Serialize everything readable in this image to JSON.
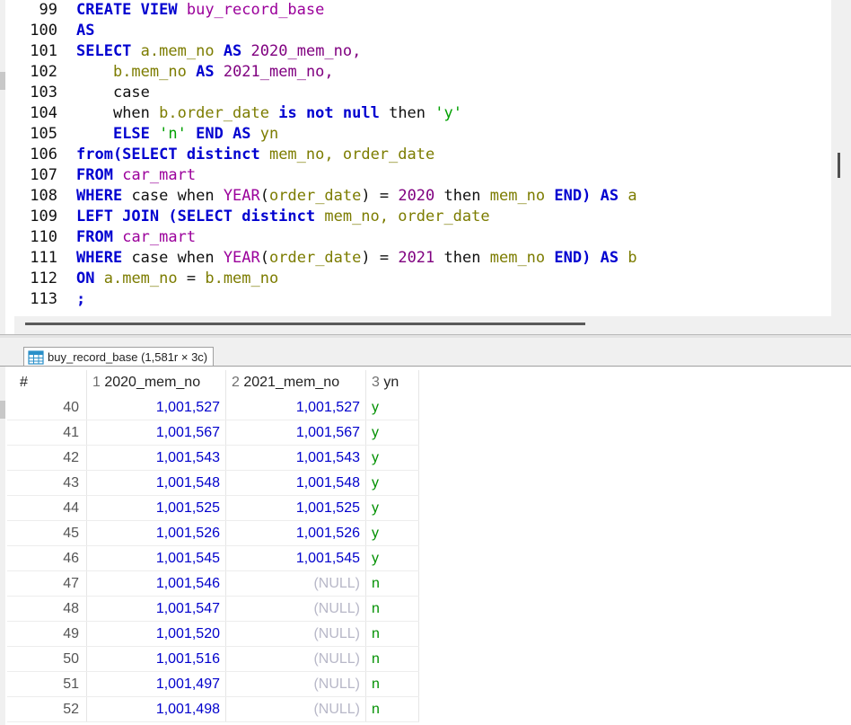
{
  "editor": {
    "lines": [
      {
        "n": "99",
        "tokens": [
          {
            "t": "CREATE VIEW",
            "c": "kw"
          },
          {
            "t": " ",
            "c": "plain"
          },
          {
            "t": "buy_record_base",
            "c": "fn"
          }
        ]
      },
      {
        "n": "100",
        "tokens": [
          {
            "t": "AS",
            "c": "kw"
          }
        ]
      },
      {
        "n": "101",
        "tokens": [
          {
            "t": "SELECT",
            "c": "kw"
          },
          {
            "t": " ",
            "c": "plain"
          },
          {
            "t": "a.mem_no",
            "c": "ident"
          },
          {
            "t": " ",
            "c": "plain"
          },
          {
            "t": "AS",
            "c": "kw"
          },
          {
            "t": " ",
            "c": "plain"
          },
          {
            "t": "2020_mem_no,",
            "c": "num"
          }
        ]
      },
      {
        "n": "102",
        "tokens": [
          {
            "t": "    ",
            "c": "plain"
          },
          {
            "t": "b.mem_no",
            "c": "ident"
          },
          {
            "t": " ",
            "c": "plain"
          },
          {
            "t": "AS",
            "c": "kw"
          },
          {
            "t": " ",
            "c": "plain"
          },
          {
            "t": "2021_mem_no,",
            "c": "num"
          }
        ]
      },
      {
        "n": "103",
        "tokens": [
          {
            "t": "    ",
            "c": "plain"
          },
          {
            "t": "case",
            "c": "plain"
          }
        ]
      },
      {
        "n": "104",
        "tokens": [
          {
            "t": "    ",
            "c": "plain"
          },
          {
            "t": "when",
            "c": "plain"
          },
          {
            "t": " ",
            "c": "plain"
          },
          {
            "t": "b.order_date",
            "c": "ident"
          },
          {
            "t": " ",
            "c": "plain"
          },
          {
            "t": "is not null",
            "c": "kw"
          },
          {
            "t": " ",
            "c": "plain"
          },
          {
            "t": "then",
            "c": "plain"
          },
          {
            "t": " ",
            "c": "plain"
          },
          {
            "t": "'y'",
            "c": "str"
          }
        ]
      },
      {
        "n": "105",
        "tokens": [
          {
            "t": "    ",
            "c": "plain"
          },
          {
            "t": "ELSE",
            "c": "kw"
          },
          {
            "t": " ",
            "c": "plain"
          },
          {
            "t": "'n'",
            "c": "str"
          },
          {
            "t": " ",
            "c": "plain"
          },
          {
            "t": "END AS",
            "c": "kw"
          },
          {
            "t": " ",
            "c": "plain"
          },
          {
            "t": "yn",
            "c": "ident"
          }
        ]
      },
      {
        "n": "106",
        "tokens": [
          {
            "t": "from(SELECT distinct",
            "c": "kw"
          },
          {
            "t": " ",
            "c": "plain"
          },
          {
            "t": "mem_no,",
            "c": "ident"
          },
          {
            "t": " ",
            "c": "plain"
          },
          {
            "t": "order_date",
            "c": "ident"
          }
        ]
      },
      {
        "n": "107",
        "tokens": [
          {
            "t": "FROM",
            "c": "kw"
          },
          {
            "t": " ",
            "c": "plain"
          },
          {
            "t": "car_mart",
            "c": "fn"
          }
        ]
      },
      {
        "n": "108",
        "tokens": [
          {
            "t": "WHERE",
            "c": "kw"
          },
          {
            "t": " ",
            "c": "plain"
          },
          {
            "t": "case when",
            "c": "plain"
          },
          {
            "t": " ",
            "c": "plain"
          },
          {
            "t": "YEAR",
            "c": "fn"
          },
          {
            "t": "(",
            "c": "plain"
          },
          {
            "t": "order_date",
            "c": "ident"
          },
          {
            "t": ") = ",
            "c": "plain"
          },
          {
            "t": "2020",
            "c": "num"
          },
          {
            "t": " ",
            "c": "plain"
          },
          {
            "t": "then",
            "c": "plain"
          },
          {
            "t": " ",
            "c": "plain"
          },
          {
            "t": "mem_no",
            "c": "ident"
          },
          {
            "t": " ",
            "c": "plain"
          },
          {
            "t": "END) AS",
            "c": "kw"
          },
          {
            "t": " ",
            "c": "plain"
          },
          {
            "t": "a",
            "c": "ident"
          }
        ]
      },
      {
        "n": "109",
        "tokens": [
          {
            "t": "LEFT JOIN (SELECT distinct",
            "c": "kw"
          },
          {
            "t": " ",
            "c": "plain"
          },
          {
            "t": "mem_no,",
            "c": "ident"
          },
          {
            "t": " ",
            "c": "plain"
          },
          {
            "t": "order_date",
            "c": "ident"
          }
        ]
      },
      {
        "n": "110",
        "tokens": [
          {
            "t": "FROM",
            "c": "kw"
          },
          {
            "t": " ",
            "c": "plain"
          },
          {
            "t": "car_mart",
            "c": "fn"
          }
        ]
      },
      {
        "n": "111",
        "tokens": [
          {
            "t": "WHERE",
            "c": "kw"
          },
          {
            "t": " ",
            "c": "plain"
          },
          {
            "t": "case when",
            "c": "plain"
          },
          {
            "t": " ",
            "c": "plain"
          },
          {
            "t": "YEAR",
            "c": "fn"
          },
          {
            "t": "(",
            "c": "plain"
          },
          {
            "t": "order_date",
            "c": "ident"
          },
          {
            "t": ") = ",
            "c": "plain"
          },
          {
            "t": "2021",
            "c": "num"
          },
          {
            "t": " ",
            "c": "plain"
          },
          {
            "t": "then",
            "c": "plain"
          },
          {
            "t": " ",
            "c": "plain"
          },
          {
            "t": "mem_no",
            "c": "ident"
          },
          {
            "t": " ",
            "c": "plain"
          },
          {
            "t": "END) AS",
            "c": "kw"
          },
          {
            "t": " ",
            "c": "plain"
          },
          {
            "t": "b",
            "c": "ident"
          }
        ]
      },
      {
        "n": "112",
        "tokens": [
          {
            "t": "ON",
            "c": "kw"
          },
          {
            "t": " ",
            "c": "plain"
          },
          {
            "t": "a.mem_no",
            "c": "ident"
          },
          {
            "t": " = ",
            "c": "plain"
          },
          {
            "t": "b.mem_no",
            "c": "ident"
          }
        ]
      },
      {
        "n": "113",
        "tokens": [
          {
            "t": ";",
            "c": "kw"
          }
        ]
      }
    ]
  },
  "results": {
    "tab_label": "buy_record_base (1,581r × 3c)",
    "columns": {
      "rownum": "#",
      "c1_idx": "1",
      "c1": "2020_mem_no",
      "c2_idx": "2",
      "c2": "2021_mem_no",
      "c3_idx": "3",
      "c3": "yn"
    },
    "rows": [
      {
        "n": "40",
        "a": "1,001,527",
        "b": "1,001,527",
        "yn": "y"
      },
      {
        "n": "41",
        "a": "1,001,567",
        "b": "1,001,567",
        "yn": "y"
      },
      {
        "n": "42",
        "a": "1,001,543",
        "b": "1,001,543",
        "yn": "y"
      },
      {
        "n": "43",
        "a": "1,001,548",
        "b": "1,001,548",
        "yn": "y"
      },
      {
        "n": "44",
        "a": "1,001,525",
        "b": "1,001,525",
        "yn": "y"
      },
      {
        "n": "45",
        "a": "1,001,526",
        "b": "1,001,526",
        "yn": "y"
      },
      {
        "n": "46",
        "a": "1,001,545",
        "b": "1,001,545",
        "yn": "y"
      },
      {
        "n": "47",
        "a": "1,001,546",
        "b": "(NULL)",
        "yn": "n"
      },
      {
        "n": "48",
        "a": "1,001,547",
        "b": "(NULL)",
        "yn": "n"
      },
      {
        "n": "49",
        "a": "1,001,520",
        "b": "(NULL)",
        "yn": "n"
      },
      {
        "n": "50",
        "a": "1,001,516",
        "b": "(NULL)",
        "yn": "n"
      },
      {
        "n": "51",
        "a": "1,001,497",
        "b": "(NULL)",
        "yn": "n"
      },
      {
        "n": "52",
        "a": "1,001,498",
        "b": "(NULL)",
        "yn": "n"
      }
    ]
  }
}
